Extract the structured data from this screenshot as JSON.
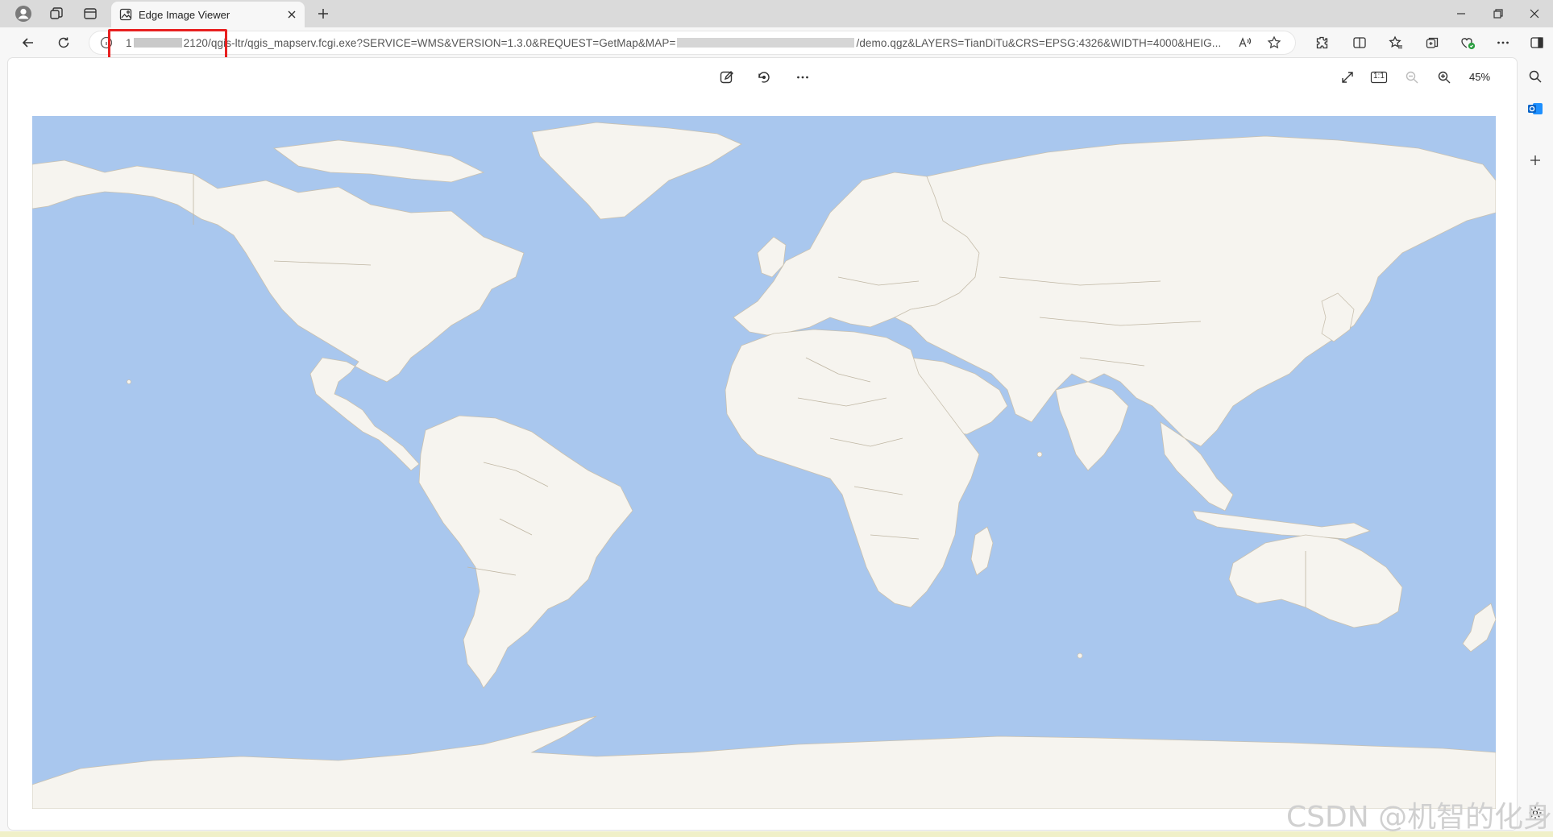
{
  "window": {
    "tab_title": "Edge Image Viewer",
    "tab_favicon": "image-icon"
  },
  "address_bar": {
    "url_prefix": "1",
    "url_port_path": "2120",
    "url_path": "/qgis-ltr/qgis_mapserv.fcgi.exe?SERVICE=WMS&VERSION=1.3.0&REQUEST=GetMap&MAP=",
    "url_suffix": "/demo.qgz&LAYERS=TianDiTu&CRS=EPSG:4326&WIDTH=4000&HEIG..."
  },
  "viewer": {
    "zoom_level": "45%",
    "fit_label": "1:1"
  },
  "watermark": "CSDN @机智的化身",
  "colors": {
    "ocean": "#a9c7ee",
    "land": "#f6f4ef",
    "highlight": "#e82020"
  }
}
